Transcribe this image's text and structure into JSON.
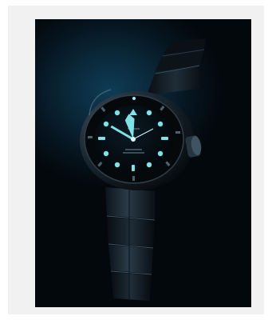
{
  "image": {
    "subject": "dive-watch",
    "colors": {
      "background_outer": "#f1f1f1",
      "backdrop_glow": "#0e3c55",
      "backdrop_dark": "#03080c",
      "lume": "#7fe3e6",
      "metal": "#1b2a35"
    }
  }
}
